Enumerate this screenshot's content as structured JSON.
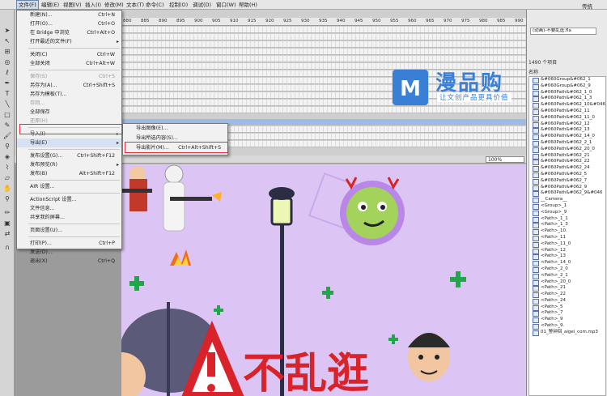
{
  "menubar": {
    "items": [
      "文件(F)",
      "编辑(E)",
      "视图(V)",
      "插入(I)",
      "修改(M)",
      "文本(T)",
      "命令(C)",
      "控制(O)",
      "调试(D)",
      "窗口(W)",
      "帮助(H)"
    ],
    "workspace": "传统"
  },
  "timeline": {
    "ruler_labels": [
      "880",
      "885",
      "890",
      "895",
      "900",
      "905",
      "910",
      "915",
      "920",
      "925",
      "930",
      "935",
      "940",
      "945",
      "950",
      "955",
      "960",
      "965",
      "970",
      "975",
      "980",
      "985",
      "990"
    ]
  },
  "file_menu": {
    "items": [
      {
        "label": "新建(N)...",
        "shortcut": "Ctrl+N"
      },
      {
        "label": "打开(O)...",
        "shortcut": "Ctrl+O"
      },
      {
        "label": "在 Bridge 中浏览",
        "shortcut": "Ctrl+Alt+O"
      },
      {
        "label": "打开最近的文件(F)",
        "shortcut": ""
      },
      {
        "label": "关闭(C)",
        "shortcut": "Ctrl+W"
      },
      {
        "label": "全部关闭",
        "shortcut": "Ctrl+Alt+W"
      },
      {
        "label": "保存(S)",
        "shortcut": "Ctrl+S"
      },
      {
        "label": "另存为(A)...",
        "shortcut": "Ctrl+Shift+S"
      },
      {
        "label": "另存为模板(T)...",
        "shortcut": ""
      },
      {
        "label": "存回...",
        "shortcut": ""
      },
      {
        "label": "全部保存",
        "shortcut": ""
      },
      {
        "label": "还原(H)",
        "shortcut": ""
      },
      {
        "label": "导入(I)",
        "shortcut": ""
      },
      {
        "label": "导出(E)",
        "shortcut": ""
      },
      {
        "label": "发布设置(G)...",
        "shortcut": "Ctrl+Shift+F12"
      },
      {
        "label": "发布预览(R)",
        "shortcut": ""
      },
      {
        "label": "发布(B)",
        "shortcut": "Alt+Shift+F12"
      },
      {
        "label": "AIR 设置...",
        "shortcut": ""
      },
      {
        "label": "ActionScript 设置...",
        "shortcut": ""
      },
      {
        "label": "文件信息...",
        "shortcut": ""
      },
      {
        "label": "共享我的屏幕...",
        "shortcut": ""
      },
      {
        "label": "页面设置(U)...",
        "shortcut": ""
      },
      {
        "label": "打印(P)...",
        "shortcut": "Ctrl+P"
      },
      {
        "label": "发送(D)...",
        "shortcut": ""
      },
      {
        "label": "退出(X)",
        "shortcut": "Ctrl+Q"
      }
    ]
  },
  "export_menu": {
    "items": [
      {
        "label": "导出图像(E)...",
        "shortcut": ""
      },
      {
        "label": "导出所选内容(S)...",
        "shortcut": ""
      },
      {
        "label": "导出影片(M)...",
        "shortcut": "Ctrl+Alt+Shift+S"
      }
    ]
  },
  "stage": {
    "zoom": "100%",
    "title_chars": "不乱逛"
  },
  "watermark": {
    "title": "漫品购",
    "subtitle": "让文创产品更具价值"
  },
  "library_panel": {
    "dropdown": "(动画)-不要乱逛.fla",
    "count": "1490 个项目",
    "name_header": "名称",
    "items": [
      "&#060Group&#062_1",
      "&#060Group&#062_9",
      "&#060Path&#062_1_0",
      "&#060Path&#062_1_3",
      "&#060Path&#062_10&#046",
      "&#060Path&#062_11",
      "&#060Path&#062_11_0",
      "&#060Path&#062_12",
      "&#060Path&#062_13",
      "&#060Path&#062_14_0",
      "&#060Path&#062_2_1",
      "&#060Path&#062_20_0",
      "&#060Path&#062_21",
      "&#060Path&#062_22",
      "&#060Path&#062_24",
      "&#060Path&#062_5",
      "&#060Path&#062_7",
      "&#060Path&#062_9",
      "&#060Path&#062_9&#046",
      "__Camera__",
      "<Group>_1",
      "<Group>_9",
      "<Path>_1_1",
      "<Path>_1_3",
      "<Path>_10.",
      "<Path>_11",
      "<Path>_11_0",
      "<Path>_12",
      "<Path>_13",
      "<Path>_14_0",
      "<Path>_2_0",
      "<Path>_2_1",
      "<Path>_20_0",
      "<Path>_21",
      "<Path>_22",
      "<Path>_24",
      "<Path>_5",
      "<Path>_7",
      "<Path>_9",
      "<Path>_9.",
      "01_警钟回_aigei_com.mp3"
    ]
  },
  "colors": {
    "menu_highlight": "#d6e2f3",
    "red_box": "#e0303a",
    "stage_bg": "#dcc5f4",
    "watermark": "#3a7fd6"
  }
}
